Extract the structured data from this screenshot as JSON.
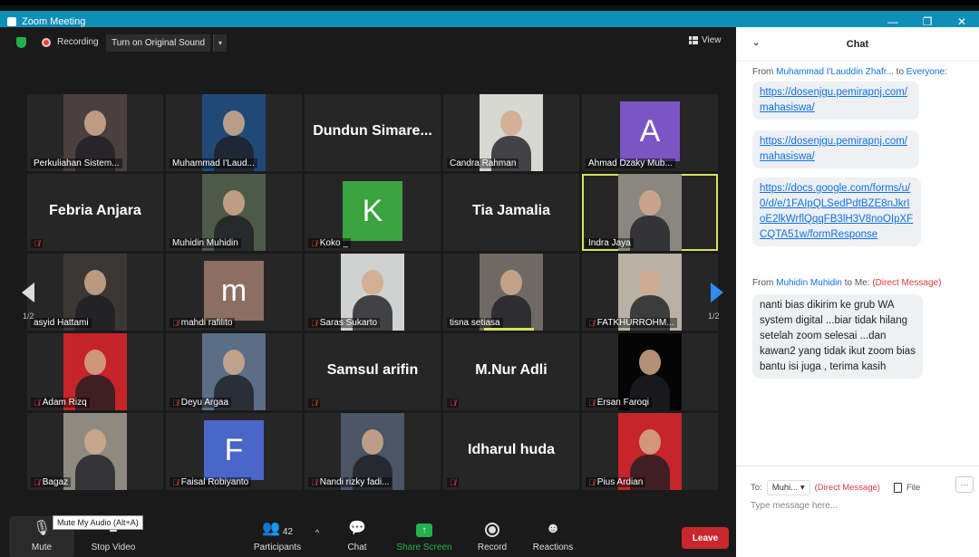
{
  "window": {
    "title": "Zoom Meeting"
  },
  "topbar": {
    "recording_label": "Recording",
    "original_sound_label": "Turn on Original Sound",
    "view_label": "View"
  },
  "pagination": {
    "left": "1/2",
    "right": "1/2"
  },
  "tiles": [
    {
      "name": "Perkuliahan Sistem...",
      "type": "photo",
      "muted": false,
      "bg": "#4a4040"
    },
    {
      "name": "Muhammad I'Laud...",
      "type": "photo",
      "muted": false,
      "bg": "#1f4a78"
    },
    {
      "name": "Dundun Simare...",
      "type": "text",
      "muted": false
    },
    {
      "name": "Candra Rahman",
      "type": "photo",
      "muted": false,
      "bg": "#d8d8d2"
    },
    {
      "name": "Ahmad Dzaky Mub...",
      "type": "avatar",
      "letter": "A",
      "avatar_color": "#7b55c4",
      "muted": false
    },
    {
      "name": "Febria Anjara",
      "type": "text",
      "muted": true
    },
    {
      "name": "Muhidin Muhidin",
      "type": "photo",
      "muted": false,
      "bg": "#4d5a48"
    },
    {
      "name": "Koko _",
      "type": "avatar",
      "letter": "K",
      "avatar_color": "#3aa33e",
      "muted": true
    },
    {
      "name": "Tia Jamalia",
      "type": "text",
      "muted": false
    },
    {
      "name": "Indra Jaya",
      "type": "photo",
      "muted": false,
      "bg": "#8a8780",
      "active": true
    },
    {
      "name": "asyid Hattami",
      "type": "photo",
      "muted": false,
      "bg": "#3b3735"
    },
    {
      "name": "mahdi rafilito",
      "type": "avatar",
      "letter": "m",
      "avatar_color": "#8d6e63",
      "muted": true
    },
    {
      "name": "Saras Sukarto",
      "type": "photo",
      "muted": true,
      "bg": "#cfd2d0"
    },
    {
      "name": "tisna setiasa",
      "type": "photo",
      "muted": false,
      "bg": "#6e6a63",
      "speaking": true
    },
    {
      "name": "FATKHURROHM...",
      "type": "photo",
      "muted": true,
      "bg": "#b9b2a4"
    },
    {
      "name": "Adam Rizq",
      "type": "photo",
      "muted": true,
      "bg": "#c4242a"
    },
    {
      "name": "Deyu Argaa",
      "type": "photo",
      "muted": true,
      "bg": "#5a6e86"
    },
    {
      "name": "Samsul arifin",
      "type": "text",
      "muted": true
    },
    {
      "name": "M.Nur Adli",
      "type": "text",
      "muted": true
    },
    {
      "name": "Ersan Faroqi",
      "type": "photo",
      "muted": true,
      "bg": "#050505"
    },
    {
      "name": "Bagaz",
      "type": "photo",
      "muted": true,
      "bg": "#8f8a80"
    },
    {
      "name": "Faisal Robiyanto",
      "type": "avatar",
      "letter": "F",
      "avatar_color": "#4a66c8",
      "muted": true
    },
    {
      "name": "Nandi rizky fadi...",
      "type": "photo",
      "muted": true,
      "bg": "#4a5566"
    },
    {
      "name": "Idharul huda",
      "type": "text",
      "muted": true
    },
    {
      "name": "Pius Ardian",
      "type": "photo",
      "muted": true,
      "bg": "#c5252b"
    }
  ],
  "toolbar": {
    "mute_label": "Mute",
    "stop_video_label": "Stop Video",
    "participants_label": "Participants",
    "participants_count": "42",
    "chat_label": "Chat",
    "share_label": "Share Screen",
    "record_label": "Record",
    "reactions_label": "Reactions",
    "leave_label": "Leave",
    "tooltip": "Mute My Audio (Alt+A)"
  },
  "chat": {
    "title": "Chat",
    "msg1_from": "From",
    "msg1_sender": "Muhammad I'Lauddin Zhafr...",
    "msg1_to": "to",
    "msg1_recipient": "Everyone:",
    "link1": "https://dosenjgu.pemirapnj.com/mahasiswa/",
    "link2": "https://dosenjgu.pemirapnj.com/mahasiswa/",
    "link3": "https://docs.google.com/forms/u/0/d/e/1FAIpQLSedPdtBZE8nJkrIoE2lkWrflQqqFB3lH3V8noOIpXFCQTA51w/formResponse",
    "msg2_from": "From",
    "msg2_sender": "Muhidin Muhidin",
    "msg2_to": "to Me:",
    "msg2_dm": "(Direct Message)",
    "msg2_text": "nanti bias dikirim ke grub WA system digital ...biar tidak hilang setelah zoom selesai ...dan kawan2 yang tidak ikut zoom bias bantu isi juga , terima kasih",
    "to_label": "To:",
    "to_value": "Muhi...",
    "to_dm": "(Direct Message)",
    "file_label": "File",
    "more_label": "···",
    "input_placeholder": "Type message here..."
  }
}
